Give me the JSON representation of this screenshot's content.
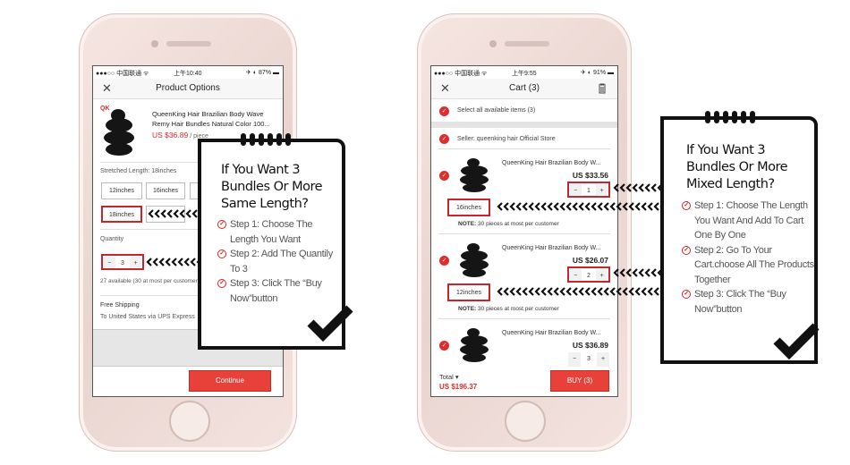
{
  "colors": {
    "accent": "#e8413a",
    "highlight": "#c8242b",
    "price": "#e02c2c"
  },
  "left_phone": {
    "status": {
      "carrier": "●●●○○ 中国联通 ᯤ",
      "time": "上午10:40",
      "battery": "✈ ◐ 87% ▬"
    },
    "header": {
      "close_icon": "close-icon",
      "title": "Product Options"
    },
    "product": {
      "title_line1": "QueenKing Hair Brazilian Body Wave",
      "title_line2": "Remy Hair Bundles Natural Color 100...",
      "price": "US $36.89",
      "unit": "/ piece",
      "logo": "QK"
    },
    "length_label": "Stretched Length: 18inches",
    "length_options": [
      "12inches",
      "16inches",
      "18inches"
    ],
    "selected_length": "18inches",
    "quantity_label": "Quantity",
    "quantity": {
      "minus": "−",
      "value": "3",
      "plus": "+"
    },
    "availability": "27 available (30  at most per customer)",
    "shipping_title": "Free Shipping",
    "shipping_detail": "To United States via UPS Express",
    "continue_label": "Continue"
  },
  "right_phone": {
    "status": {
      "carrier": "●●●○○ 中国联通 ᯤ",
      "time": "上午9:55",
      "battery": "✈ ◐ 91% ▬"
    },
    "header": {
      "close_icon": "close-icon",
      "title": "Cart (3)",
      "trash_icon": "trash-icon"
    },
    "select_all": "Select all available items (3)",
    "seller": "Seller: queenking hair Official Store",
    "items": [
      {
        "title": "QueenKing Hair Brazilian Body W...",
        "price": "US $33.56",
        "qty": "1",
        "length": "16inches",
        "note_label": "NOTE:",
        "note": " 30 pieces at most per customer"
      },
      {
        "title": "QueenKing Hair Brazilian Body W...",
        "price": "US $26.07",
        "qty": "2",
        "length": "12inches",
        "note_label": "NOTE:",
        "note": " 30 pieces at most per customer"
      },
      {
        "title": "QueenKing Hair Brazilian Body W...",
        "price": "US $36.89",
        "qty": "3"
      }
    ],
    "minus": "−",
    "plus": "+",
    "total_label": "Total ▾",
    "total_value": "US $196.37",
    "buy_label": "BUY (3)"
  },
  "note_same": {
    "title": "If You Want 3 Bundles Or More Same Length?",
    "steps": [
      "Step 1: Choose The Length You Want",
      "Step 2: Add The Quantily To 3",
      "Step 3: Click The “Buy Now”button"
    ]
  },
  "note_mixed": {
    "title": "If You Want 3 Bundles Or More Mixed Length?",
    "steps": [
      "Step 1: Choose The Length You Want And Add To Cart One By One",
      "Step 2: Go To Your Cart.choose All The Products Together",
      "Step 3: Click The “Buy Now”button"
    ]
  }
}
